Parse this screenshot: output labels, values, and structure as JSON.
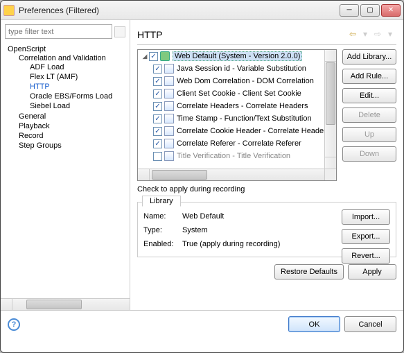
{
  "window": {
    "title": "Preferences (Filtered)"
  },
  "filter": {
    "placeholder": "type filter text"
  },
  "tree": {
    "root": "OpenScript",
    "items": [
      {
        "label": "Correlation and Validation",
        "children": [
          {
            "label": "ADF Load"
          },
          {
            "label": "Flex LT (AMF)"
          },
          {
            "label": "HTTP",
            "selected": true
          },
          {
            "label": "Oracle EBS/Forms Load"
          },
          {
            "label": "Siebel Load"
          }
        ]
      },
      {
        "label": "General"
      },
      {
        "label": "Playback"
      },
      {
        "label": "Record"
      },
      {
        "label": "Step Groups"
      }
    ]
  },
  "page": {
    "title": "HTTP"
  },
  "rules": {
    "root": "Web Default (System - Version 2.0.0)",
    "items": [
      "Java Session id - Variable Substitution",
      "Web Dom Correlation - DOM Correlation",
      "Client Set Cookie - Client Set Cookie",
      "Correlate Headers - Correlate Headers",
      "Time Stamp - Function/Text Substitution",
      "Correlate Cookie Header - Correlate Headers",
      "Correlate Referer - Correlate Referer",
      "Title Verification - Title Verification"
    ]
  },
  "sideButtons": {
    "addLibrary": "Add Library...",
    "addRule": "Add Rule...",
    "edit": "Edit...",
    "delete": "Delete",
    "up": "Up",
    "down": "Down"
  },
  "caption": "Check to apply during recording",
  "library": {
    "tab": "Library",
    "nameLabel": "Name:",
    "typeLabel": "Type:",
    "enabledLabel": "Enabled:",
    "name": "Web Default",
    "type": "System",
    "enabled": "True (apply during recording)",
    "import": "Import...",
    "export": "Export...",
    "revert": "Revert..."
  },
  "lower": {
    "restore": "Restore Defaults",
    "apply": "Apply"
  },
  "footer": {
    "ok": "OK",
    "cancel": "Cancel"
  }
}
